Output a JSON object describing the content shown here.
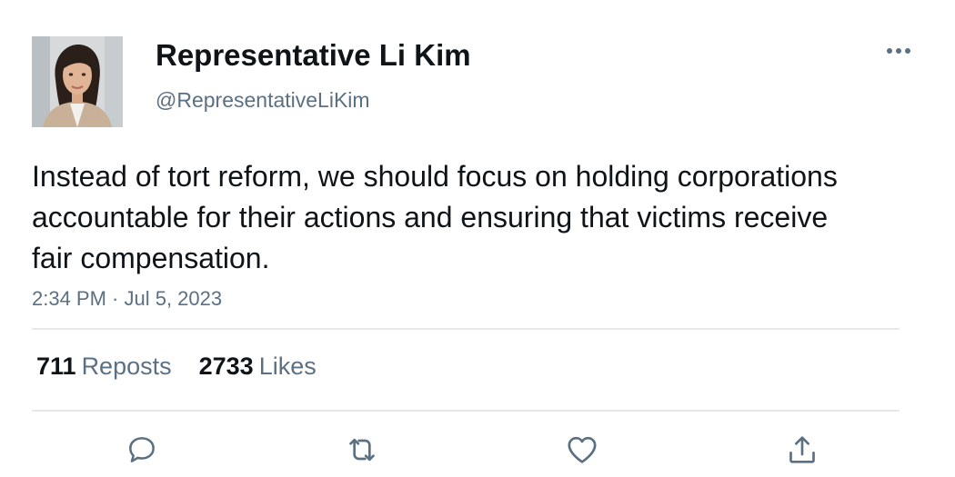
{
  "profile": {
    "display_name": "Representative Li Kim",
    "handle": "@RepresentativeLiKim"
  },
  "tweet": {
    "text": "Instead of tort reform, we should focus on holding corporations accountable for their actions and ensuring that victims receive fair compensation.",
    "timestamp": "2:34 PM · Jul 5, 2023"
  },
  "stats": {
    "reposts_count": "711",
    "reposts_label": "Reposts",
    "likes_count": "2733",
    "likes_label": "Likes"
  },
  "icons": {
    "more": "more-horizontal-icon",
    "reply": "reply-icon",
    "repost": "repost-icon",
    "like": "heart-icon",
    "share": "share-icon"
  },
  "colors": {
    "text_primary": "#0f1419",
    "text_secondary": "#5b7083",
    "divider": "#e6e8eb",
    "icon": "#5b7083"
  }
}
